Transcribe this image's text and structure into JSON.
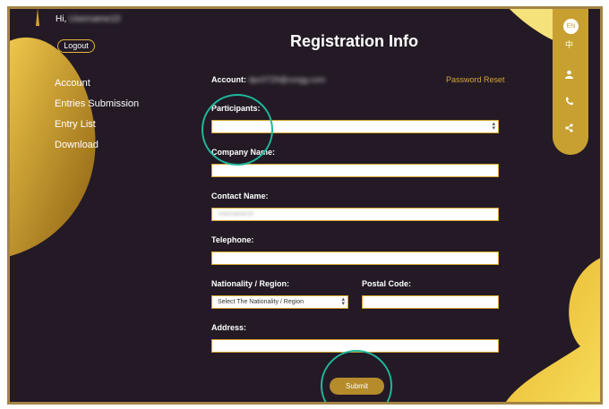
{
  "header": {
    "greeting": "Hi,",
    "username": "Username10",
    "logout_label": "Logout"
  },
  "nav": {
    "items": [
      {
        "label": "Account"
      },
      {
        "label": "Entries Submission"
      },
      {
        "label": "Entry List"
      },
      {
        "label": "Download"
      }
    ]
  },
  "page_title": "Registration Info",
  "form": {
    "account_label": "Account:",
    "account_value": "dpc0729@corgg.com",
    "password_reset": "Password Reset",
    "participants_label": "Participants:",
    "company_label": "Company Name:",
    "contact_label": "Contact Name:",
    "contact_placeholder": "Username10",
    "telephone_label": "Telephone:",
    "nationality_label": "Nationality / Region:",
    "nationality_value": "Select The Nationality / Region",
    "postal_label": "Postal Code:",
    "address_label": "Address:",
    "submit_label": "Submit"
  },
  "sidebar_right": {
    "lang_en": "EN",
    "lang_zh": "中"
  },
  "colors": {
    "background": "#231a26",
    "accent": "#d6a52e",
    "annotation": "#1fb89c"
  }
}
